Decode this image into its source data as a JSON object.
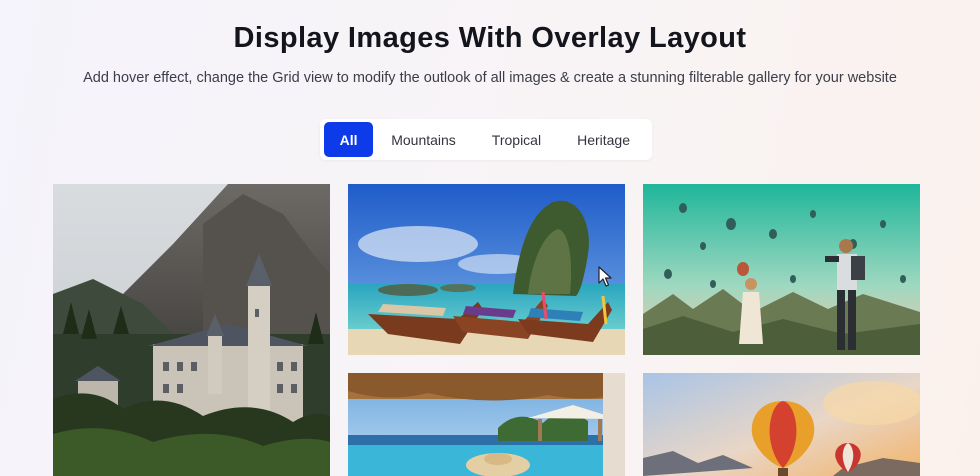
{
  "header": {
    "title": "Display Images With Overlay Layout",
    "subtitle": "Add hover effect, change the Grid view to modify the outlook of all images & create a stunning filterable gallery for your website"
  },
  "filters": [
    {
      "label": "All",
      "active": true
    },
    {
      "label": "Mountains",
      "active": false
    },
    {
      "label": "Tropical",
      "active": false
    },
    {
      "label": "Heritage",
      "active": false
    }
  ],
  "gallery": [
    {
      "subject": "castle-mountain"
    },
    {
      "subject": "longtail-boats-island"
    },
    {
      "subject": "hot-air-balloons-couple"
    },
    {
      "subject": "resort-pool"
    },
    {
      "subject": "hot-air-balloons-sunset"
    }
  ],
  "colors": {
    "accent": "#0d3bea"
  }
}
